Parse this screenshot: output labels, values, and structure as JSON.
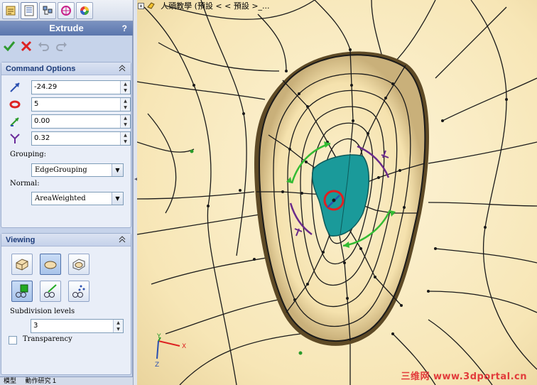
{
  "window": {
    "tree_text": "人頭教學 (預設 < < 預設 >_..."
  },
  "property_manager": {
    "tabs": [
      "feature-manager",
      "property-manager",
      "configuration-manager",
      "dimxpert-manager",
      "display-manager"
    ],
    "title": "Extrude",
    "help": "?",
    "actions": [
      "ok",
      "cancel",
      "undo",
      "redo"
    ],
    "command_options": {
      "header": "Command Options",
      "fields": [
        {
          "icon": "extrude-distance-icon",
          "value": "-24.29"
        },
        {
          "icon": "segments-icon",
          "value": "5"
        },
        {
          "icon": "angle-icon",
          "value": "0.00"
        },
        {
          "icon": "taper-icon",
          "value": "0.32"
        }
      ],
      "grouping_label": "Grouping:",
      "grouping_value": "EdgeGrouping",
      "normal_label": "Normal:",
      "normal_value": "AreaWeighted"
    },
    "viewing": {
      "header": "Viewing",
      "subdivision_label": "Subdivision levels",
      "subdivision_value": "3",
      "transparency_label": "Transparency",
      "transparency_checked": false
    },
    "bottom_tabs": [
      "模型",
      "動作研究 1"
    ]
  },
  "viewport": {
    "triad": {
      "x_label": "X",
      "y_label": "Y",
      "z_label": "Z"
    },
    "watermark": "三维网 www.3dportal.cn",
    "colors": {
      "surface": "#fbeec5",
      "mesh_lines": "#1a1a1a",
      "selected_face": "#1a9a9a",
      "handle_green": "#33bb33",
      "handle_purple": "#6a2a8a",
      "handle_red": "#e02020"
    }
  }
}
